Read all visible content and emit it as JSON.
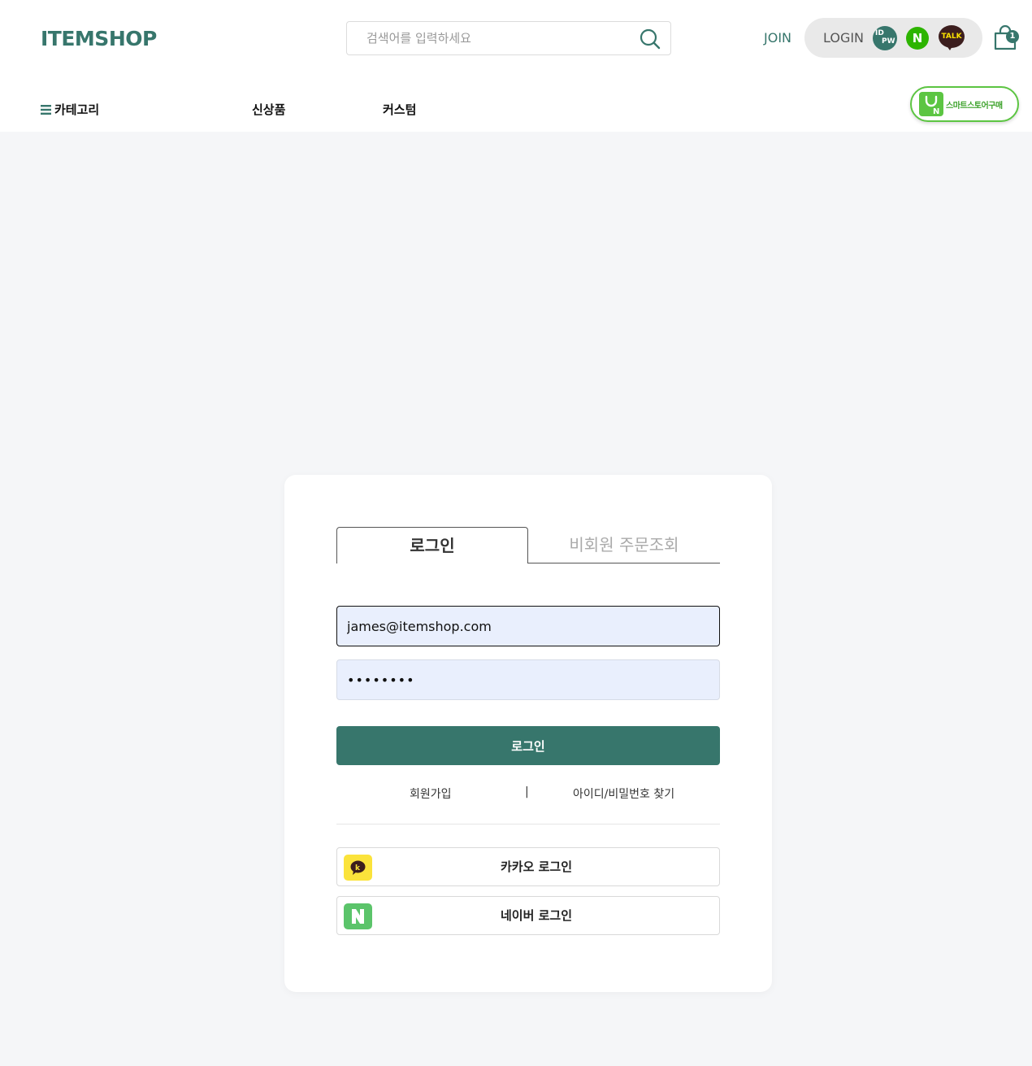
{
  "header": {
    "logo": "ITEMSHOP",
    "search": {
      "placeholder": "검색어를 입력하세요",
      "value": ""
    },
    "join_label": "JOIN",
    "login_label": "LOGIN",
    "login_icons": {
      "idpw_top": "ID",
      "idpw_bottom": "PW",
      "naver": "N",
      "kakao_talk": "TALK"
    },
    "cart_count": "1",
    "nav": {
      "category": "카테고리",
      "new": "신상품",
      "custom": "커스텀"
    },
    "smartstore_label": "스마트스토어구매"
  },
  "login_card": {
    "tabs": {
      "login": "로그인",
      "guest_order": "비회원 주문조회"
    },
    "email": {
      "value": "james@itemshop.com",
      "placeholder": ""
    },
    "password": {
      "value": "••••••••"
    },
    "login_button": "로그인",
    "links": {
      "signup": "회원가입",
      "separator": "|",
      "find": "아이디/비밀번호 찾기"
    },
    "social": {
      "kakao": "카카오 로그인",
      "naver": "네이버 로그인"
    }
  },
  "colors": {
    "brand": "#37766c",
    "field_bg": "#e9effd",
    "kakao": "#fbe33b",
    "naver": "#5bc46a",
    "smartstore": "#5cc542"
  },
  "icons": [
    "search-icon",
    "cart-icon",
    "menu-icon",
    "kakao-icon",
    "naver-icon",
    "smartstore-bag-icon",
    "idpw-icon",
    "kakao-talk-icon"
  ]
}
